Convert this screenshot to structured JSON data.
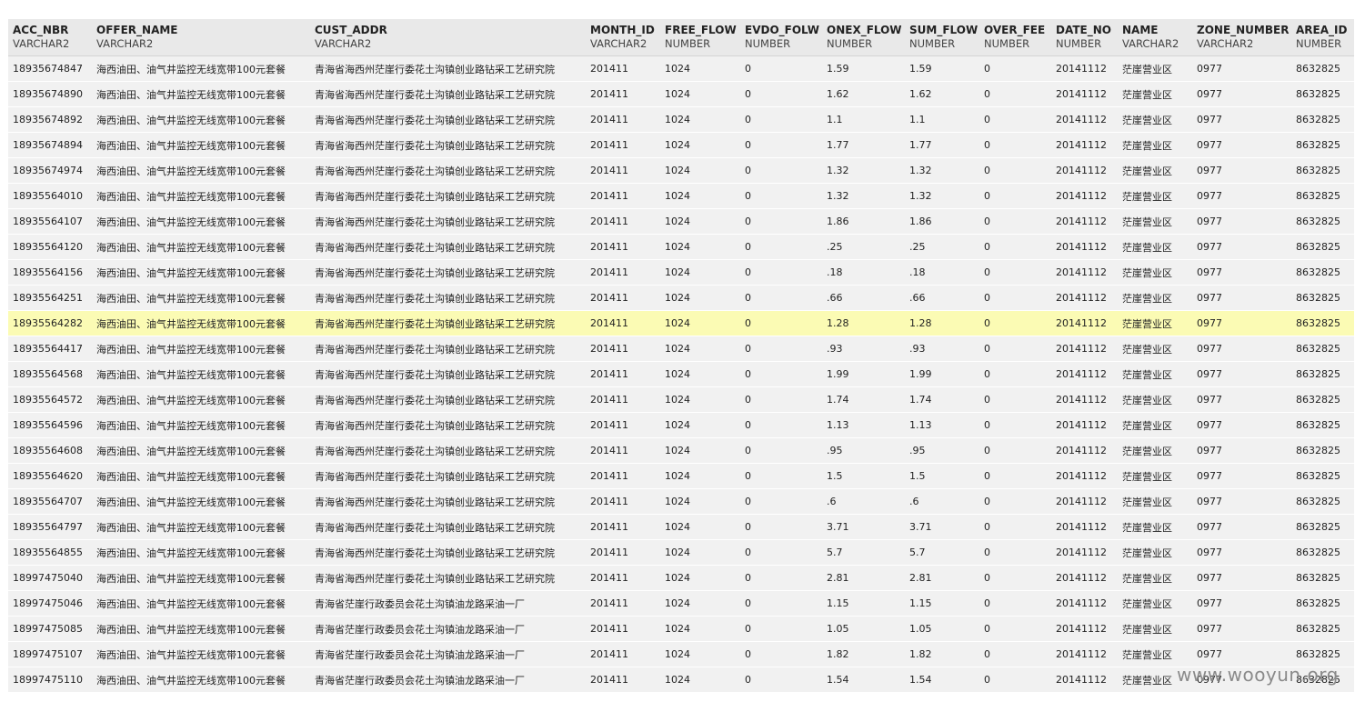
{
  "grid": {
    "columns": [
      {
        "name": "ACC_NBR",
        "type": "VARCHAR2"
      },
      {
        "name": "OFFER_NAME",
        "type": "VARCHAR2"
      },
      {
        "name": "CUST_ADDR",
        "type": "VARCHAR2"
      },
      {
        "name": "MONTH_ID",
        "type": "VARCHAR2"
      },
      {
        "name": "FREE_FLOW",
        "type": "NUMBER"
      },
      {
        "name": "EVDO_FOLW",
        "type": "NUMBER"
      },
      {
        "name": "ONEX_FLOW",
        "type": "NUMBER"
      },
      {
        "name": "SUM_FLOW",
        "type": "NUMBER"
      },
      {
        "name": "OVER_FEE",
        "type": "NUMBER"
      },
      {
        "name": "DATE_NO",
        "type": "NUMBER"
      },
      {
        "name": "NAME",
        "type": "VARCHAR2"
      },
      {
        "name": "ZONE_NUMBER",
        "type": "VARCHAR2"
      },
      {
        "name": "AREA_ID",
        "type": "NUMBER"
      }
    ],
    "highlight_row_index": 10,
    "highlight_color": "#fbfbb4",
    "rows": [
      [
        "18935674847",
        "海西油田、油气井监控无线宽带100元套餐",
        "青海省海西州茫崖行委花土沟镇创业路钻采工艺研究院",
        "201411",
        "1024",
        "0",
        "1.59",
        "1.59",
        "0",
        "20141112",
        "茫崖营业区",
        "0977",
        "8632825"
      ],
      [
        "18935674890",
        "海西油田、油气井监控无线宽带100元套餐",
        "青海省海西州茫崖行委花土沟镇创业路钻采工艺研究院",
        "201411",
        "1024",
        "0",
        "1.62",
        "1.62",
        "0",
        "20141112",
        "茫崖营业区",
        "0977",
        "8632825"
      ],
      [
        "18935674892",
        "海西油田、油气井监控无线宽带100元套餐",
        "青海省海西州茫崖行委花土沟镇创业路钻采工艺研究院",
        "201411",
        "1024",
        "0",
        "1.1",
        "1.1",
        "0",
        "20141112",
        "茫崖营业区",
        "0977",
        "8632825"
      ],
      [
        "18935674894",
        "海西油田、油气井监控无线宽带100元套餐",
        "青海省海西州茫崖行委花土沟镇创业路钻采工艺研究院",
        "201411",
        "1024",
        "0",
        "1.77",
        "1.77",
        "0",
        "20141112",
        "茫崖营业区",
        "0977",
        "8632825"
      ],
      [
        "18935674974",
        "海西油田、油气井监控无线宽带100元套餐",
        "青海省海西州茫崖行委花土沟镇创业路钻采工艺研究院",
        "201411",
        "1024",
        "0",
        "1.32",
        "1.32",
        "0",
        "20141112",
        "茫崖营业区",
        "0977",
        "8632825"
      ],
      [
        "18935564010",
        "海西油田、油气井监控无线宽带100元套餐",
        "青海省海西州茫崖行委花土沟镇创业路钻采工艺研究院",
        "201411",
        "1024",
        "0",
        "1.32",
        "1.32",
        "0",
        "20141112",
        "茫崖营业区",
        "0977",
        "8632825"
      ],
      [
        "18935564107",
        "海西油田、油气井监控无线宽带100元套餐",
        "青海省海西州茫崖行委花土沟镇创业路钻采工艺研究院",
        "201411",
        "1024",
        "0",
        "1.86",
        "1.86",
        "0",
        "20141112",
        "茫崖营业区",
        "0977",
        "8632825"
      ],
      [
        "18935564120",
        "海西油田、油气井监控无线宽带100元套餐",
        "青海省海西州茫崖行委花土沟镇创业路钻采工艺研究院",
        "201411",
        "1024",
        "0",
        ".25",
        ".25",
        "0",
        "20141112",
        "茫崖营业区",
        "0977",
        "8632825"
      ],
      [
        "18935564156",
        "海西油田、油气井监控无线宽带100元套餐",
        "青海省海西州茫崖行委花土沟镇创业路钻采工艺研究院",
        "201411",
        "1024",
        "0",
        ".18",
        ".18",
        "0",
        "20141112",
        "茫崖营业区",
        "0977",
        "8632825"
      ],
      [
        "18935564251",
        "海西油田、油气井监控无线宽带100元套餐",
        "青海省海西州茫崖行委花土沟镇创业路钻采工艺研究院",
        "201411",
        "1024",
        "0",
        ".66",
        ".66",
        "0",
        "20141112",
        "茫崖营业区",
        "0977",
        "8632825"
      ],
      [
        "18935564282",
        "海西油田、油气井监控无线宽带100元套餐",
        "青海省海西州茫崖行委花土沟镇创业路钻采工艺研究院",
        "201411",
        "1024",
        "0",
        "1.28",
        "1.28",
        "0",
        "20141112",
        "茫崖营业区",
        "0977",
        "8632825"
      ],
      [
        "18935564417",
        "海西油田、油气井监控无线宽带100元套餐",
        "青海省海西州茫崖行委花土沟镇创业路钻采工艺研究院",
        "201411",
        "1024",
        "0",
        ".93",
        ".93",
        "0",
        "20141112",
        "茫崖营业区",
        "0977",
        "8632825"
      ],
      [
        "18935564568",
        "海西油田、油气井监控无线宽带100元套餐",
        "青海省海西州茫崖行委花土沟镇创业路钻采工艺研究院",
        "201411",
        "1024",
        "0",
        "1.99",
        "1.99",
        "0",
        "20141112",
        "茫崖营业区",
        "0977",
        "8632825"
      ],
      [
        "18935564572",
        "海西油田、油气井监控无线宽带100元套餐",
        "青海省海西州茫崖行委花土沟镇创业路钻采工艺研究院",
        "201411",
        "1024",
        "0",
        "1.74",
        "1.74",
        "0",
        "20141112",
        "茫崖营业区",
        "0977",
        "8632825"
      ],
      [
        "18935564596",
        "海西油田、油气井监控无线宽带100元套餐",
        "青海省海西州茫崖行委花土沟镇创业路钻采工艺研究院",
        "201411",
        "1024",
        "0",
        "1.13",
        "1.13",
        "0",
        "20141112",
        "茫崖营业区",
        "0977",
        "8632825"
      ],
      [
        "18935564608",
        "海西油田、油气井监控无线宽带100元套餐",
        "青海省海西州茫崖行委花土沟镇创业路钻采工艺研究院",
        "201411",
        "1024",
        "0",
        ".95",
        ".95",
        "0",
        "20141112",
        "茫崖营业区",
        "0977",
        "8632825"
      ],
      [
        "18935564620",
        "海西油田、油气井监控无线宽带100元套餐",
        "青海省海西州茫崖行委花土沟镇创业路钻采工艺研究院",
        "201411",
        "1024",
        "0",
        "1.5",
        "1.5",
        "0",
        "20141112",
        "茫崖营业区",
        "0977",
        "8632825"
      ],
      [
        "18935564707",
        "海西油田、油气井监控无线宽带100元套餐",
        "青海省海西州茫崖行委花土沟镇创业路钻采工艺研究院",
        "201411",
        "1024",
        "0",
        ".6",
        ".6",
        "0",
        "20141112",
        "茫崖营业区",
        "0977",
        "8632825"
      ],
      [
        "18935564797",
        "海西油田、油气井监控无线宽带100元套餐",
        "青海省海西州茫崖行委花土沟镇创业路钻采工艺研究院",
        "201411",
        "1024",
        "0",
        "3.71",
        "3.71",
        "0",
        "20141112",
        "茫崖营业区",
        "0977",
        "8632825"
      ],
      [
        "18935564855",
        "海西油田、油气井监控无线宽带100元套餐",
        "青海省海西州茫崖行委花土沟镇创业路钻采工艺研究院",
        "201411",
        "1024",
        "0",
        "5.7",
        "5.7",
        "0",
        "20141112",
        "茫崖营业区",
        "0977",
        "8632825"
      ],
      [
        "18997475040",
        "海西油田、油气井监控无线宽带100元套餐",
        "青海省海西州茫崖行委花土沟镇创业路钻采工艺研究院",
        "201411",
        "1024",
        "0",
        "2.81",
        "2.81",
        "0",
        "20141112",
        "茫崖营业区",
        "0977",
        "8632825"
      ],
      [
        "18997475046",
        "海西油田、油气井监控无线宽带100元套餐",
        "青海省茫崖行政委员会花土沟镇油龙路采油一厂",
        "201411",
        "1024",
        "0",
        "1.15",
        "1.15",
        "0",
        "20141112",
        "茫崖营业区",
        "0977",
        "8632825"
      ],
      [
        "18997475085",
        "海西油田、油气井监控无线宽带100元套餐",
        "青海省茫崖行政委员会花土沟镇油龙路采油一厂",
        "201411",
        "1024",
        "0",
        "1.05",
        "1.05",
        "0",
        "20141112",
        "茫崖营业区",
        "0977",
        "8632825"
      ],
      [
        "18997475107",
        "海西油田、油气井监控无线宽带100元套餐",
        "青海省茫崖行政委员会花土沟镇油龙路采油一厂",
        "201411",
        "1024",
        "0",
        "1.82",
        "1.82",
        "0",
        "20141112",
        "茫崖营业区",
        "0977",
        "8632825"
      ],
      [
        "18997475110",
        "海西油田、油气井监控无线宽带100元套餐",
        "青海省茫崖行政委员会花土沟镇油龙路采油一厂",
        "201411",
        "1024",
        "0",
        "1.54",
        "1.54",
        "0",
        "20141112",
        "茫崖营业区",
        "0977",
        "8632825"
      ]
    ]
  },
  "watermark": "www.wooyun.org"
}
